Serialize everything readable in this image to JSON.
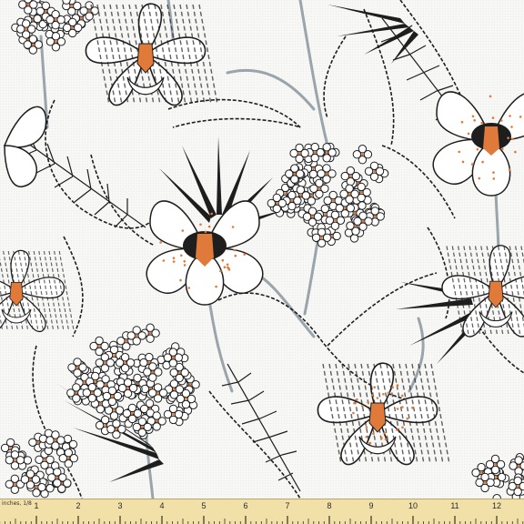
{
  "image": {
    "subject": "printed fabric swatch",
    "palette": {
      "background": "#f7f7f6",
      "ink": "#1e1e1e",
      "stem": "#9aa4ab",
      "petal": "#ffffff",
      "accent": "#e07a3a",
      "ruler": "#f1e0a8"
    }
  },
  "ruler": {
    "unit_label": "inches, 1/8",
    "numbers": [
      "1",
      "2",
      "3",
      "4",
      "5",
      "6",
      "7",
      "8",
      "9",
      "10",
      "11",
      "12"
    ]
  }
}
